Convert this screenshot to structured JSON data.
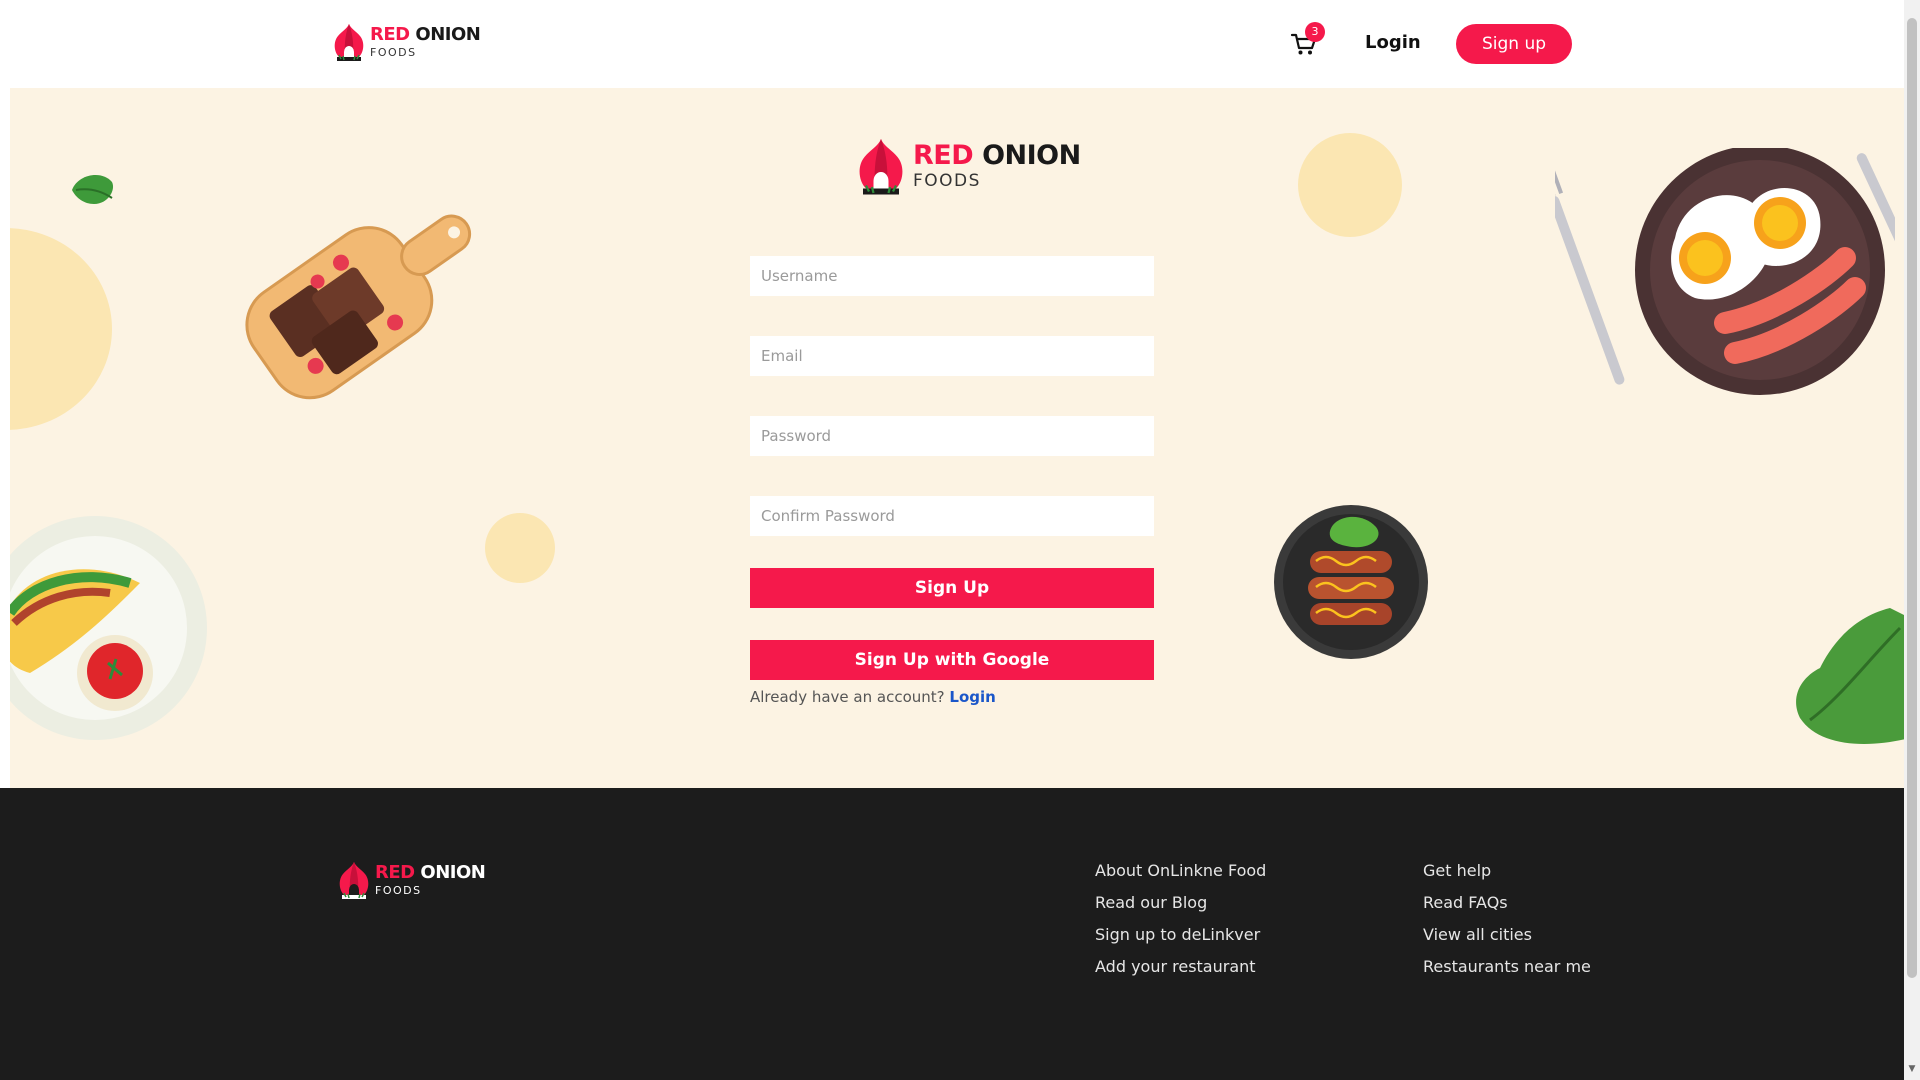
{
  "header": {
    "logo": {
      "brand_red": "RED",
      "brand_dark": "ONION",
      "sub": "FOODS"
    },
    "cart": {
      "icon": "cart-icon",
      "count": "3"
    },
    "login_label": "Login",
    "signup_label": "Sign up"
  },
  "form": {
    "logo": {
      "brand_red": "RED",
      "brand_dark": "ONION",
      "sub": "FOODS"
    },
    "username_placeholder": "Username",
    "email_placeholder": "Email",
    "password_placeholder": "Password",
    "confirm_password_placeholder": "Confirm Password",
    "signup_button": "Sign Up",
    "google_button": "Sign Up with Google",
    "already_text": "Already have an account?",
    "login_link": "Login"
  },
  "footer": {
    "logo": {
      "brand_red": "RED",
      "brand_dark": "ONION",
      "sub": "FOODS"
    },
    "col1": [
      "About OnLinkne Food",
      "Read our Blog",
      "Sign up to deLinkver",
      "Add your restaurant"
    ],
    "col2": [
      "Get help",
      "Read FAQs",
      "View all cities",
      "Restaurants near me"
    ]
  },
  "colors": {
    "accent": "#f5194b",
    "banner_bg": "#fcf3e3",
    "footer_bg": "#1c1c1c",
    "link_blue": "#1a56c9"
  }
}
